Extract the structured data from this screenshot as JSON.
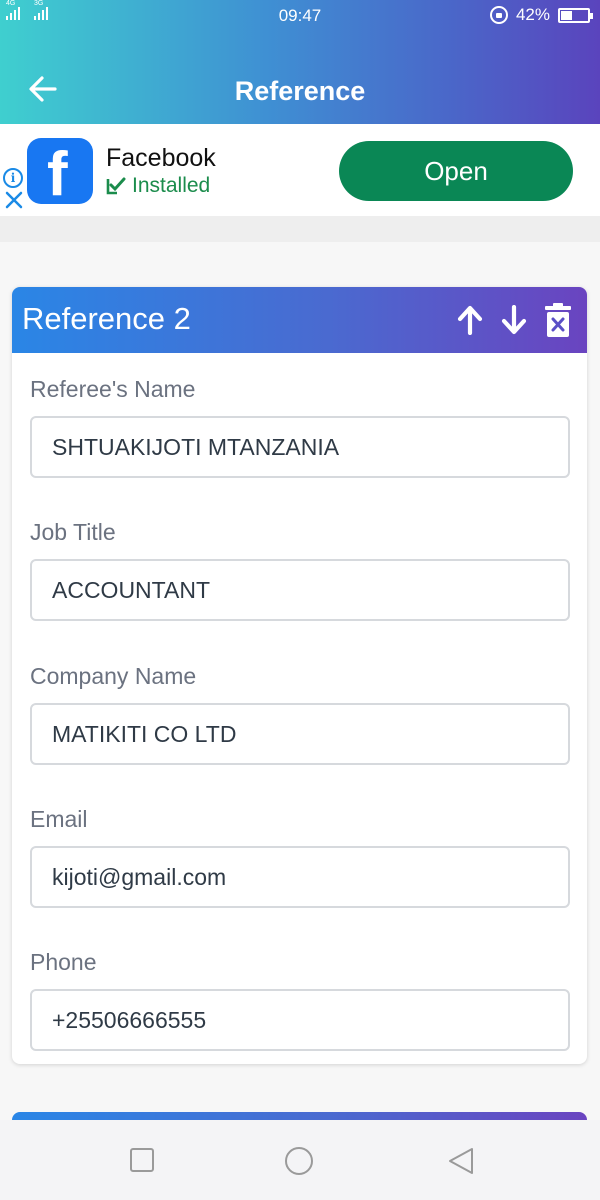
{
  "status_bar": {
    "network_1": "4G",
    "network_2": "3G",
    "time": "09:47",
    "battery_percent": "42%",
    "battery_level": 0.42
  },
  "app_bar": {
    "title": "Reference",
    "back_icon": "arrow-left-icon"
  },
  "ad": {
    "app_name": "Facebook",
    "status": "Installed",
    "button_label": "Open",
    "logo_letter": "f",
    "info_icon": "info-icon",
    "close_icon": "close-icon"
  },
  "reference_card": {
    "title": "Reference 2",
    "actions": [
      "arrow-up-icon",
      "arrow-down-icon",
      "trash-icon"
    ],
    "fields": [
      {
        "label": "Referee's Name",
        "value": "SHTUAKIJOTI MTANZANIA"
      },
      {
        "label": "Job Title",
        "value": "ACCOUNTANT"
      },
      {
        "label": "Company Name",
        "value": "MATIKITI CO LTD"
      },
      {
        "label": "Email",
        "value": "kijoti@gmail.com"
      },
      {
        "label": "Phone",
        "value": "+25506666555"
      }
    ]
  },
  "nav_bar": {
    "buttons": [
      "recent-apps-icon",
      "home-icon",
      "back-icon"
    ]
  },
  "colors": {
    "header_gradient_start": "#3fcfcf",
    "header_gradient_end": "#5a44bd",
    "open_button": "#0a8755",
    "facebook_blue": "#1877f2"
  }
}
